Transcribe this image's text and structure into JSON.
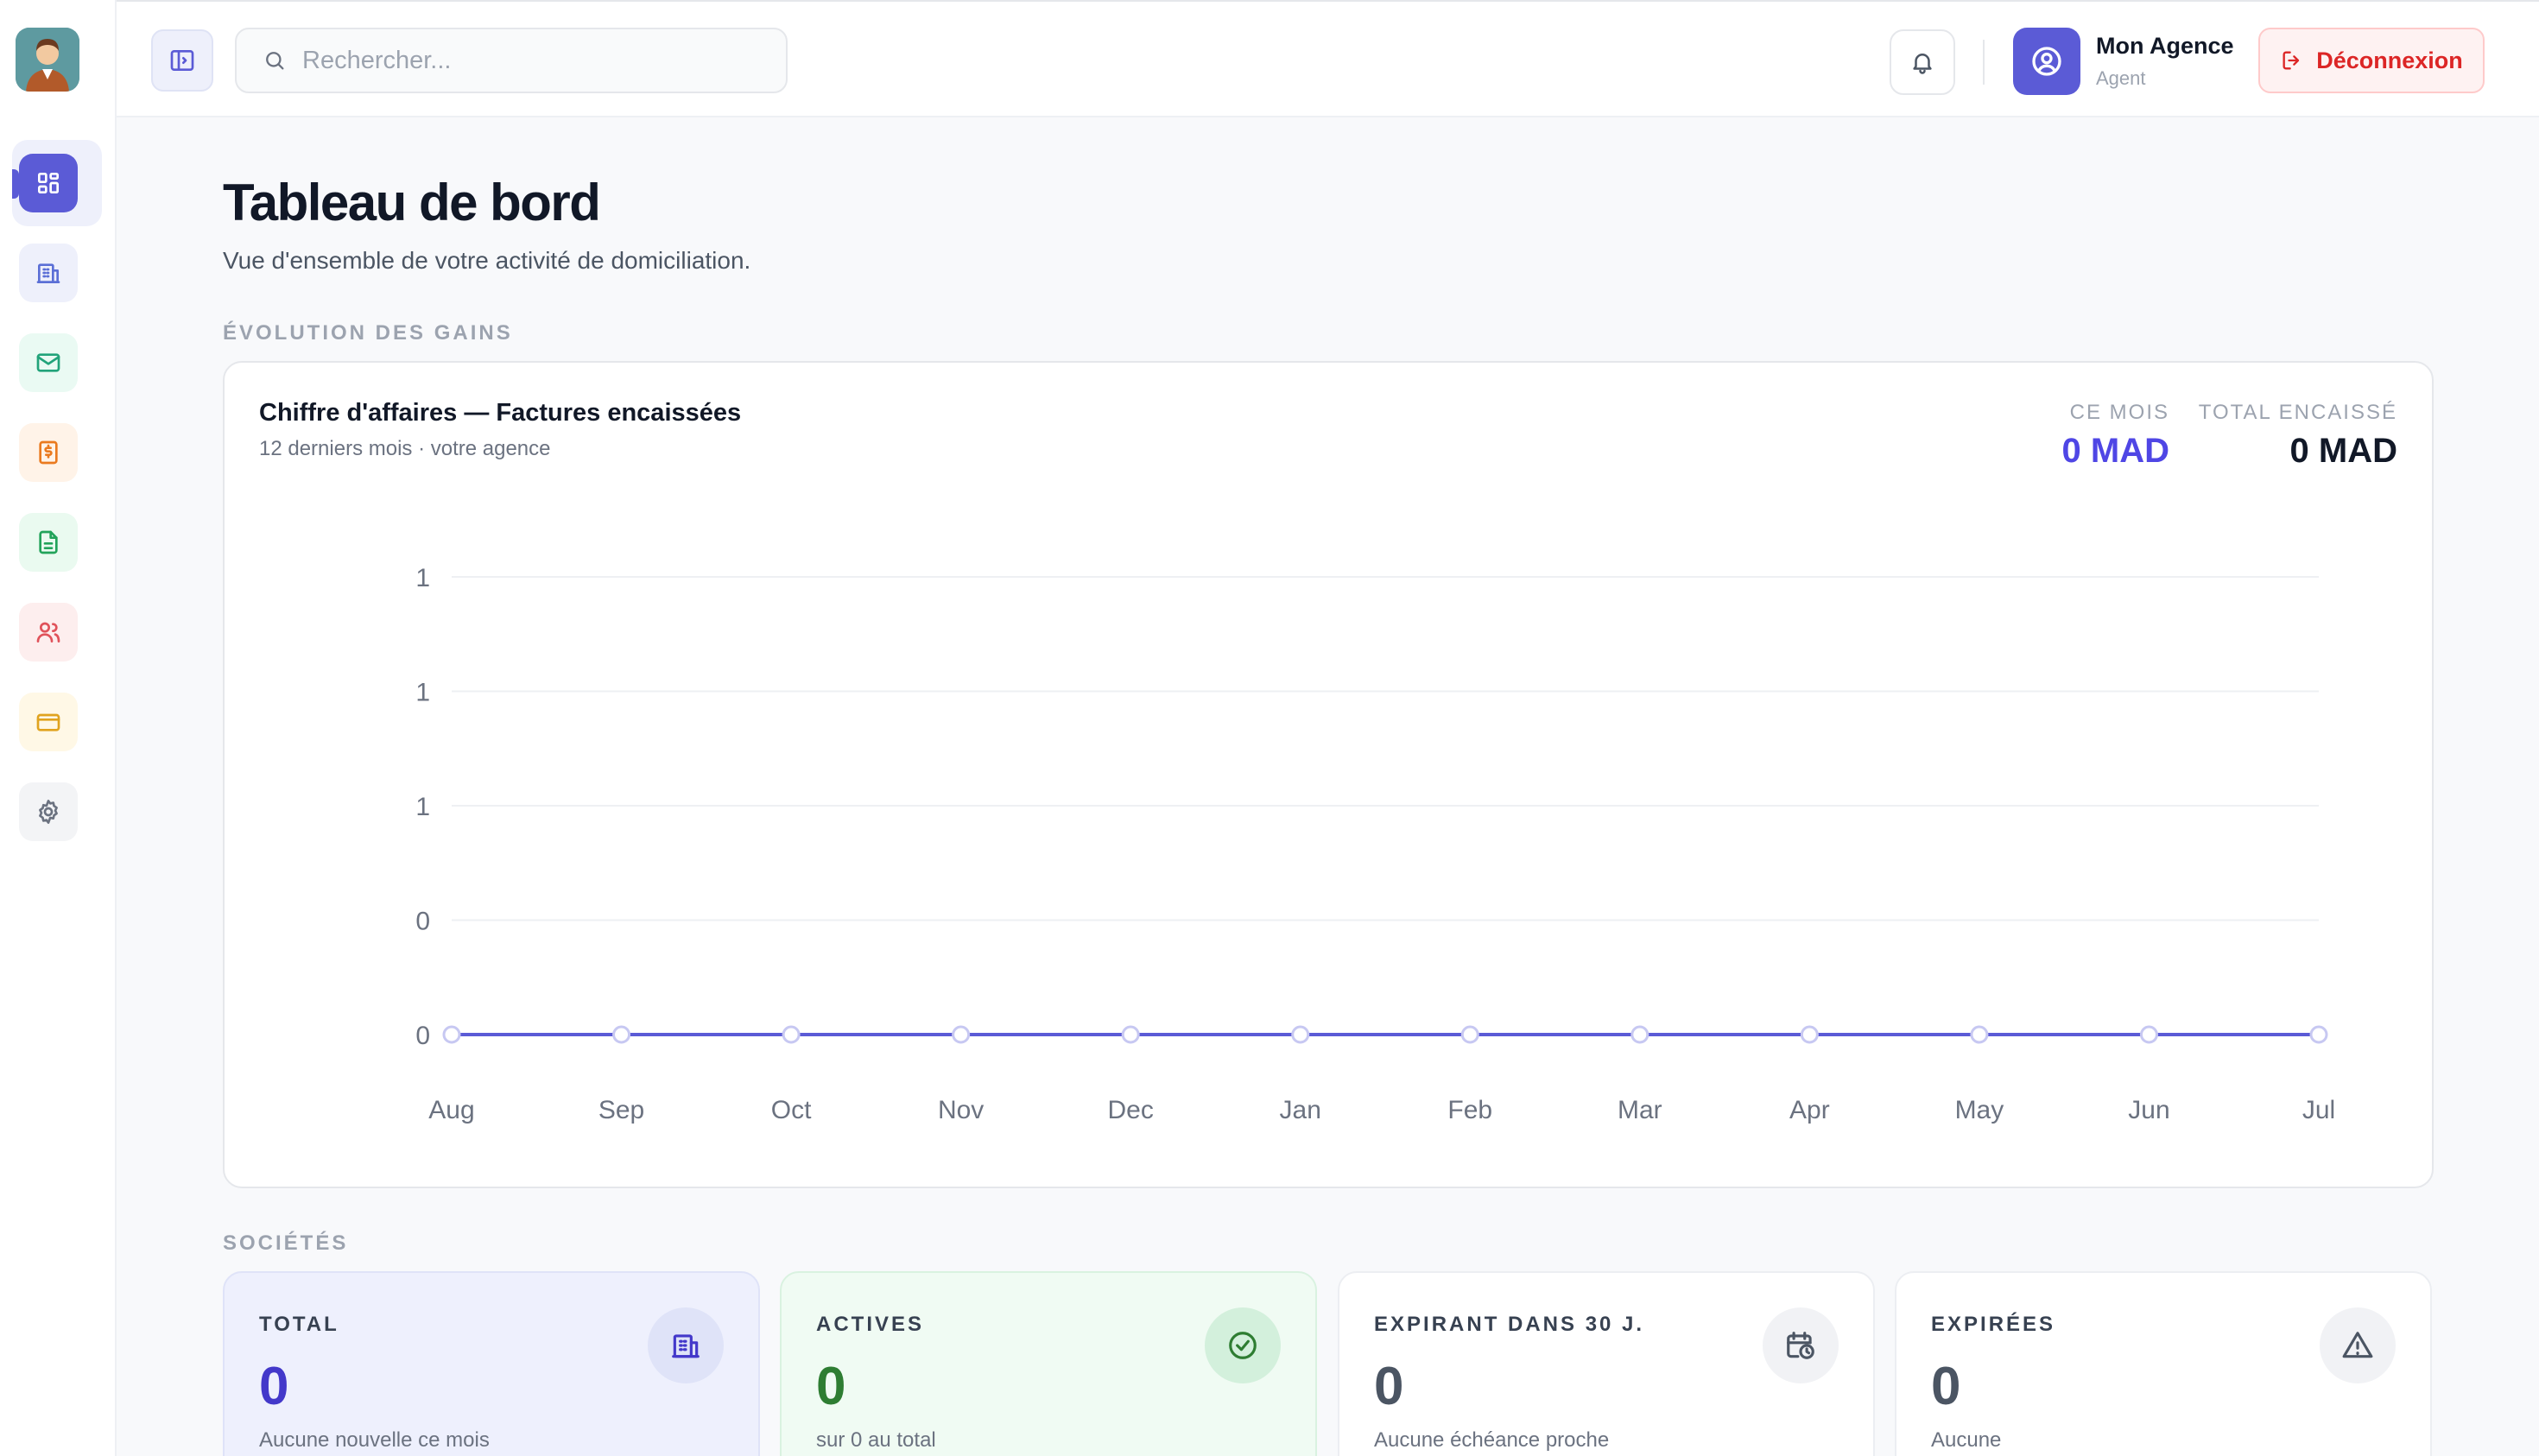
{
  "header": {
    "search_placeholder": "Rechercher...",
    "user_name": "Mon Agence",
    "user_role": "Agent",
    "logout_label": "Déconnexion"
  },
  "sidebar": {
    "items": [
      {
        "name": "dashboard",
        "icon": "grid-icon",
        "color": "#5b5bd6",
        "bg": "#5b5bd6",
        "active": true
      },
      {
        "name": "companies",
        "icon": "building-icon",
        "color": "#5b6fd6",
        "bg": "#eef0fb"
      },
      {
        "name": "mail",
        "icon": "mail-icon",
        "color": "#22a37a",
        "bg": "#eafaf3"
      },
      {
        "name": "invoices",
        "icon": "invoice-icon",
        "color": "#ea7a1f",
        "bg": "#fff3e8"
      },
      {
        "name": "documents",
        "icon": "document-icon",
        "color": "#22a35a",
        "bg": "#eafaf0"
      },
      {
        "name": "clients",
        "icon": "users-icon",
        "color": "#e0525a",
        "bg": "#fdeeee"
      },
      {
        "name": "payments",
        "icon": "card-icon",
        "color": "#e0a31f",
        "bg": "#fff8e6"
      },
      {
        "name": "settings",
        "icon": "gear-icon",
        "color": "#6b7280",
        "bg": "#f3f4f6"
      }
    ]
  },
  "page": {
    "title": "Tableau de bord",
    "subtitle": "Vue d'ensemble de votre activité de domiciliation."
  },
  "sections": {
    "earnings": "ÉVOLUTION DES GAINS",
    "companies": "SOCIÉTÉS"
  },
  "chart_card": {
    "title": "Chiffre d'affaires — Factures encaissées",
    "subtitle": "12 derniers mois · votre agence",
    "this_month_label": "CE MOIS",
    "this_month_value": "0 MAD",
    "total_label": "TOTAL ENCAISSÉ",
    "total_value": "0 MAD"
  },
  "chart_data": {
    "type": "line",
    "categories": [
      "Aug",
      "Sep",
      "Oct",
      "Nov",
      "Dec",
      "Jan",
      "Feb",
      "Mar",
      "Apr",
      "May",
      "Jun",
      "Jul"
    ],
    "series": [
      {
        "values": [
          0,
          0,
          0,
          0,
          0,
          0,
          0,
          0,
          0,
          0,
          0,
          0
        ],
        "color": "#5b5bd6"
      }
    ],
    "y_ticks": [
      "1",
      "1",
      "1",
      "0",
      "0"
    ],
    "ylim": [
      0,
      1
    ],
    "grid": true
  },
  "kpis": [
    {
      "label": "TOTAL",
      "value": "0",
      "note": "Aucune nouvelle ce mois",
      "icon": "building-icon",
      "color": "#4338ca",
      "label_color": "#374151",
      "bg": "#eef0fd",
      "border": "#dfe3f8",
      "icon_bg": "#dfe3f8"
    },
    {
      "label": "ACTIVES",
      "value": "0",
      "note": "sur 0 au total",
      "icon": "check-circle-icon",
      "color": "#2e7d32",
      "label_color": "#374151",
      "bg": "#f0fbf3",
      "border": "#d9f2e0",
      "icon_bg": "#d3f0dc"
    },
    {
      "label": "EXPIRANT DANS 30 J.",
      "value": "0",
      "note": "Aucune échéance proche",
      "icon": "calendar-clock-icon",
      "color": "#4b5563",
      "label_color": "#374151",
      "bg": "#ffffff",
      "border": "#eceef2",
      "icon_bg": "#f1f2f5"
    },
    {
      "label": "EXPIRÉES",
      "value": "0",
      "note": "Aucune",
      "icon": "warning-icon",
      "color": "#4b5563",
      "label_color": "#374151",
      "bg": "#ffffff",
      "border": "#eceef2",
      "icon_bg": "#f1f2f5"
    }
  ]
}
